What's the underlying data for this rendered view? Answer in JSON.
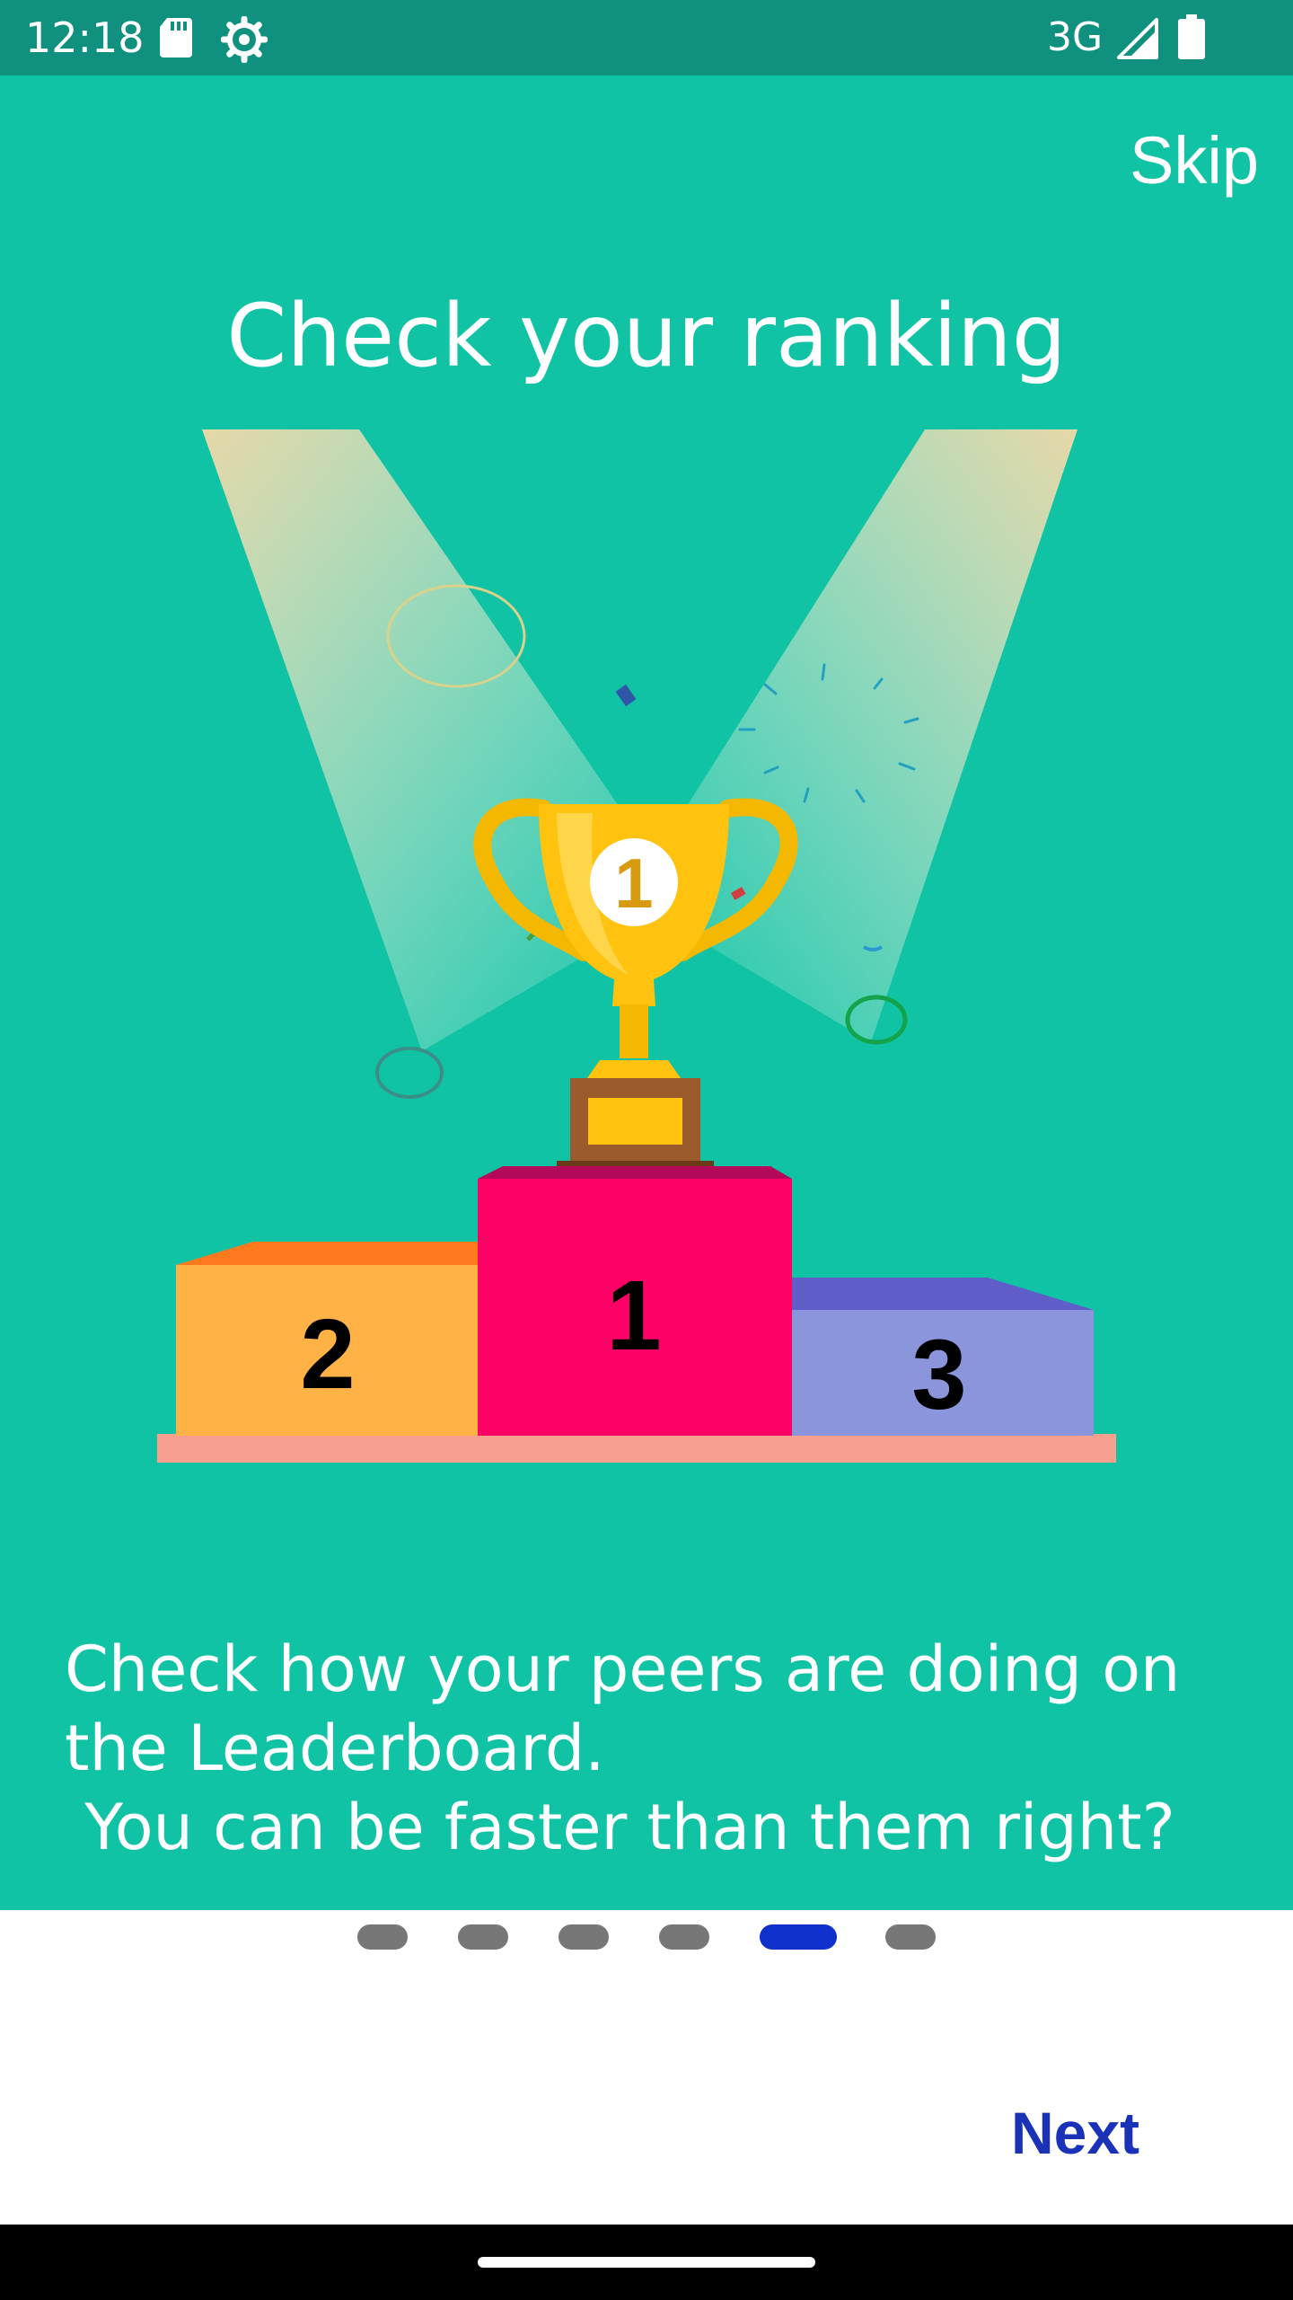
{
  "status_bar": {
    "time": "12:18",
    "network": "3G",
    "icons": [
      "sd-card-icon",
      "settings-gear-icon",
      "signal-icon",
      "battery-icon"
    ]
  },
  "header": {
    "skip_label": "Skip"
  },
  "page": {
    "title": "Check your ranking",
    "description": "Check how your peers are doing on the Leaderboard.\n You can be faster than them right?"
  },
  "illustration": {
    "trophy_label": "1",
    "podium": {
      "first": "1",
      "second": "2",
      "third": "3"
    }
  },
  "pagination": {
    "total": 6,
    "active_index": 4
  },
  "footer": {
    "next_label": "Next"
  },
  "colors": {
    "status_bar": "#10907f",
    "background": "#10c3a5",
    "active_dot": "#1030cc",
    "inactive_dot": "#777777",
    "next_text": "#1a32b8",
    "podium_first": "#ff0066",
    "podium_second": "#ffb347",
    "podium_third": "#8b95dc"
  }
}
